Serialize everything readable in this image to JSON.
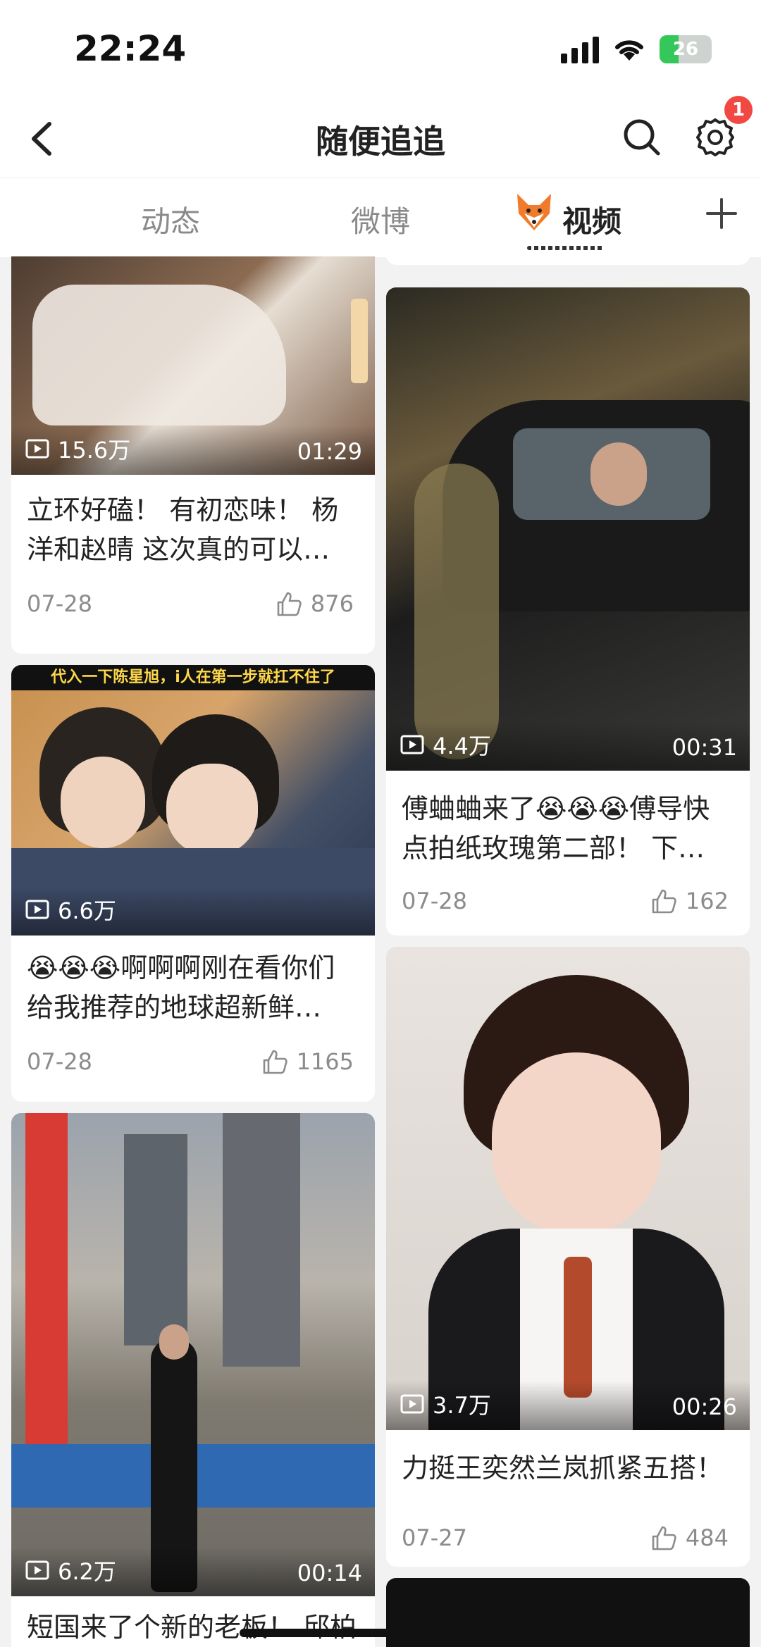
{
  "status": {
    "time": "22:24",
    "battery": "26"
  },
  "nav": {
    "title": "随便追追",
    "badge_count": "1"
  },
  "tabs": [
    {
      "label": "动态",
      "active": false
    },
    {
      "label": "微博",
      "active": false
    },
    {
      "label": "视频",
      "active": true
    }
  ],
  "cards": [
    {
      "views": "15.6万",
      "duration": "01:29",
      "title": "立环好磕！ 有初恋味！ 杨洋和赵晴 这次真的可以…",
      "date": "07-28",
      "likes": "876"
    },
    {
      "views": "4.4万",
      "duration": "00:31",
      "title": "傅蛐蛐来了😭😭😭傅导快点拍纸玫瑰第二部！ 下…",
      "date": "07-28",
      "likes": "162"
    },
    {
      "views": "6.6万",
      "duration": "",
      "overlay": "代入一下陈星旭，i人在第一步就扛不住了",
      "title": "😭😭😭啊啊啊刚在看你们给我推荐的地球超新鲜…",
      "date": "07-28",
      "likes": "1165"
    },
    {
      "views": "3.7万",
      "duration": "00:26",
      "title": "力挺王奕然兰岚抓紧五搭！",
      "date": "07-27",
      "likes": "484"
    },
    {
      "views": "6.2万",
      "duration": "00:14",
      "title": "短国来了个新的老板！ 邱柏",
      "date": "",
      "likes": ""
    }
  ],
  "colors": {
    "accent": "#f24843",
    "text": "#222222",
    "muted": "#8c8c8c",
    "background": "#f2f2f2"
  }
}
